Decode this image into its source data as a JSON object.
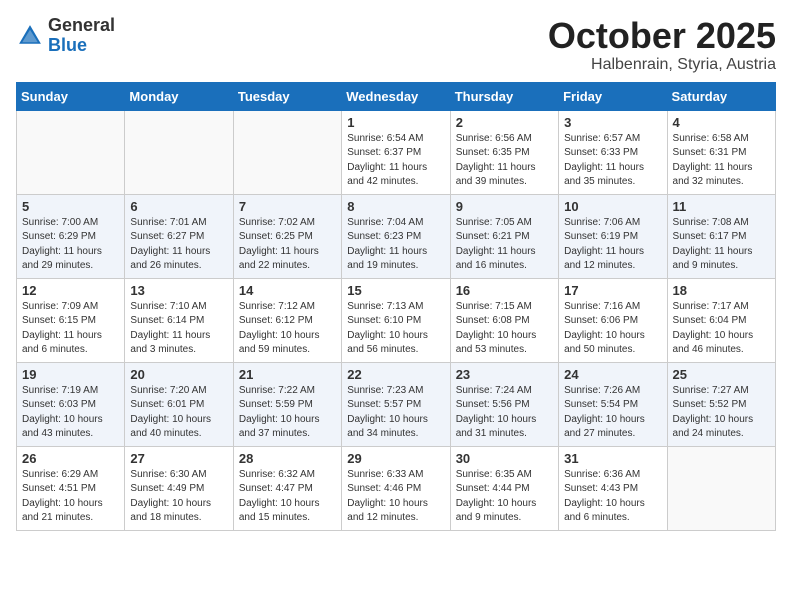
{
  "header": {
    "logo": {
      "general": "General",
      "blue": "Blue"
    },
    "month": "October 2025",
    "location": "Halbenrain, Styria, Austria"
  },
  "weekdays": [
    "Sunday",
    "Monday",
    "Tuesday",
    "Wednesday",
    "Thursday",
    "Friday",
    "Saturday"
  ],
  "weeks": [
    [
      {
        "day": "",
        "info": ""
      },
      {
        "day": "",
        "info": ""
      },
      {
        "day": "",
        "info": ""
      },
      {
        "day": "1",
        "info": "Sunrise: 6:54 AM\nSunset: 6:37 PM\nDaylight: 11 hours\nand 42 minutes."
      },
      {
        "day": "2",
        "info": "Sunrise: 6:56 AM\nSunset: 6:35 PM\nDaylight: 11 hours\nand 39 minutes."
      },
      {
        "day": "3",
        "info": "Sunrise: 6:57 AM\nSunset: 6:33 PM\nDaylight: 11 hours\nand 35 minutes."
      },
      {
        "day": "4",
        "info": "Sunrise: 6:58 AM\nSunset: 6:31 PM\nDaylight: 11 hours\nand 32 minutes."
      }
    ],
    [
      {
        "day": "5",
        "info": "Sunrise: 7:00 AM\nSunset: 6:29 PM\nDaylight: 11 hours\nand 29 minutes."
      },
      {
        "day": "6",
        "info": "Sunrise: 7:01 AM\nSunset: 6:27 PM\nDaylight: 11 hours\nand 26 minutes."
      },
      {
        "day": "7",
        "info": "Sunrise: 7:02 AM\nSunset: 6:25 PM\nDaylight: 11 hours\nand 22 minutes."
      },
      {
        "day": "8",
        "info": "Sunrise: 7:04 AM\nSunset: 6:23 PM\nDaylight: 11 hours\nand 19 minutes."
      },
      {
        "day": "9",
        "info": "Sunrise: 7:05 AM\nSunset: 6:21 PM\nDaylight: 11 hours\nand 16 minutes."
      },
      {
        "day": "10",
        "info": "Sunrise: 7:06 AM\nSunset: 6:19 PM\nDaylight: 11 hours\nand 12 minutes."
      },
      {
        "day": "11",
        "info": "Sunrise: 7:08 AM\nSunset: 6:17 PM\nDaylight: 11 hours\nand 9 minutes."
      }
    ],
    [
      {
        "day": "12",
        "info": "Sunrise: 7:09 AM\nSunset: 6:15 PM\nDaylight: 11 hours\nand 6 minutes."
      },
      {
        "day": "13",
        "info": "Sunrise: 7:10 AM\nSunset: 6:14 PM\nDaylight: 11 hours\nand 3 minutes."
      },
      {
        "day": "14",
        "info": "Sunrise: 7:12 AM\nSunset: 6:12 PM\nDaylight: 10 hours\nand 59 minutes."
      },
      {
        "day": "15",
        "info": "Sunrise: 7:13 AM\nSunset: 6:10 PM\nDaylight: 10 hours\nand 56 minutes."
      },
      {
        "day": "16",
        "info": "Sunrise: 7:15 AM\nSunset: 6:08 PM\nDaylight: 10 hours\nand 53 minutes."
      },
      {
        "day": "17",
        "info": "Sunrise: 7:16 AM\nSunset: 6:06 PM\nDaylight: 10 hours\nand 50 minutes."
      },
      {
        "day": "18",
        "info": "Sunrise: 7:17 AM\nSunset: 6:04 PM\nDaylight: 10 hours\nand 46 minutes."
      }
    ],
    [
      {
        "day": "19",
        "info": "Sunrise: 7:19 AM\nSunset: 6:03 PM\nDaylight: 10 hours\nand 43 minutes."
      },
      {
        "day": "20",
        "info": "Sunrise: 7:20 AM\nSunset: 6:01 PM\nDaylight: 10 hours\nand 40 minutes."
      },
      {
        "day": "21",
        "info": "Sunrise: 7:22 AM\nSunset: 5:59 PM\nDaylight: 10 hours\nand 37 minutes."
      },
      {
        "day": "22",
        "info": "Sunrise: 7:23 AM\nSunset: 5:57 PM\nDaylight: 10 hours\nand 34 minutes."
      },
      {
        "day": "23",
        "info": "Sunrise: 7:24 AM\nSunset: 5:56 PM\nDaylight: 10 hours\nand 31 minutes."
      },
      {
        "day": "24",
        "info": "Sunrise: 7:26 AM\nSunset: 5:54 PM\nDaylight: 10 hours\nand 27 minutes."
      },
      {
        "day": "25",
        "info": "Sunrise: 7:27 AM\nSunset: 5:52 PM\nDaylight: 10 hours\nand 24 minutes."
      }
    ],
    [
      {
        "day": "26",
        "info": "Sunrise: 6:29 AM\nSunset: 4:51 PM\nDaylight: 10 hours\nand 21 minutes."
      },
      {
        "day": "27",
        "info": "Sunrise: 6:30 AM\nSunset: 4:49 PM\nDaylight: 10 hours\nand 18 minutes."
      },
      {
        "day": "28",
        "info": "Sunrise: 6:32 AM\nSunset: 4:47 PM\nDaylight: 10 hours\nand 15 minutes."
      },
      {
        "day": "29",
        "info": "Sunrise: 6:33 AM\nSunset: 4:46 PM\nDaylight: 10 hours\nand 12 minutes."
      },
      {
        "day": "30",
        "info": "Sunrise: 6:35 AM\nSunset: 4:44 PM\nDaylight: 10 hours\nand 9 minutes."
      },
      {
        "day": "31",
        "info": "Sunrise: 6:36 AM\nSunset: 4:43 PM\nDaylight: 10 hours\nand 6 minutes."
      },
      {
        "day": "",
        "info": ""
      }
    ]
  ]
}
